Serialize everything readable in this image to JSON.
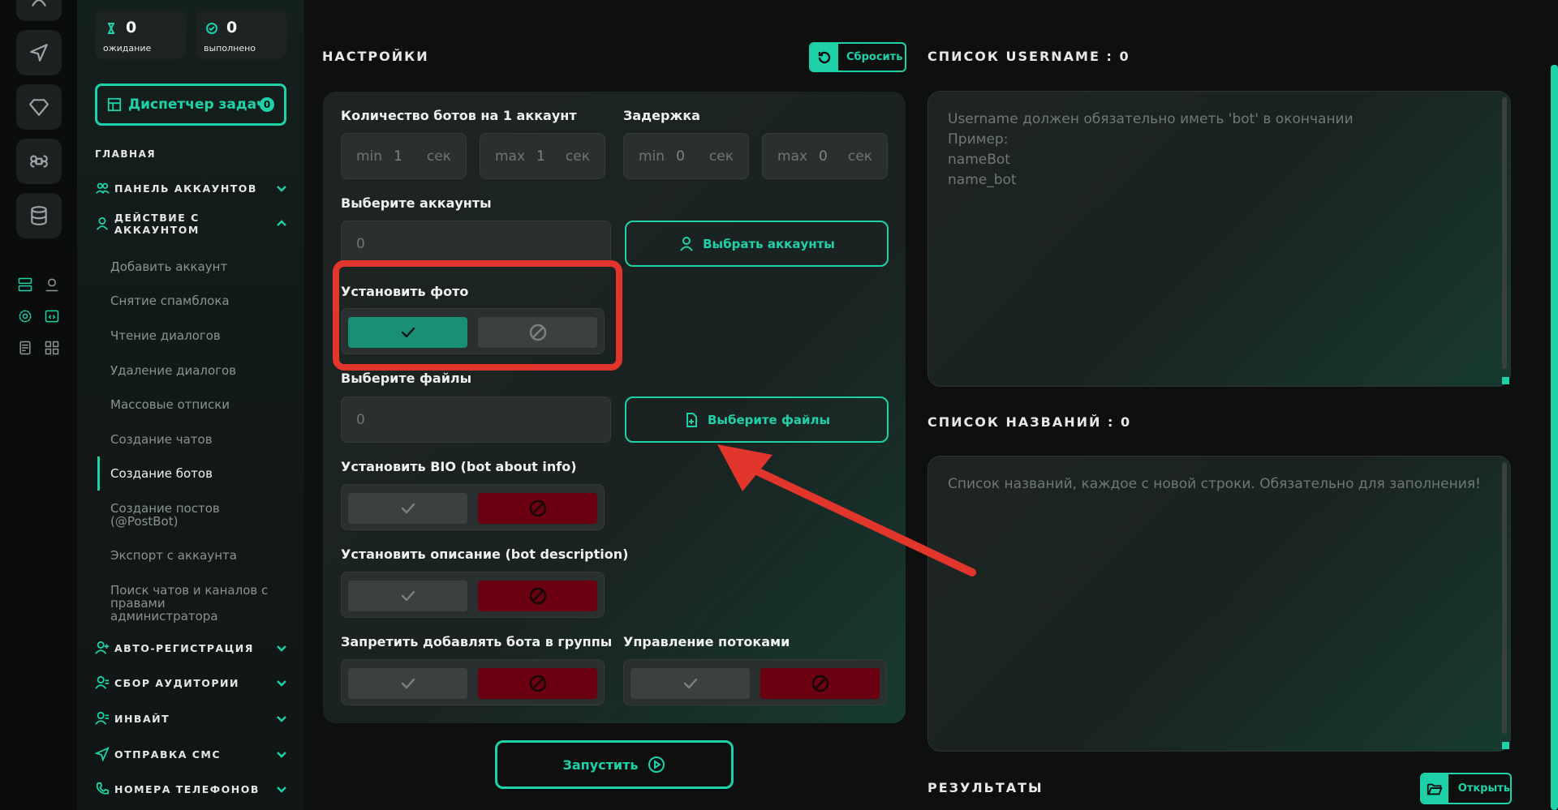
{
  "colors": {
    "accent": "#1fd1a9",
    "danger": "#6b0010",
    "highlight": "#e2352b"
  },
  "stats": [
    {
      "icon": "hourglass-icon",
      "value": "0",
      "label": "ожидание"
    },
    {
      "icon": "check-circle-icon",
      "value": "0",
      "label": "выполнено"
    }
  ],
  "dispatcher": {
    "label": "Диспетчер задач",
    "count": "0"
  },
  "sidebar": {
    "section_title": "ГЛАВНАЯ",
    "groups_top": [
      {
        "label": "ПАНЕЛЬ АККАУНТОВ"
      },
      {
        "label": "ДЕЙСТВИЕ С АККАУНТОМ"
      }
    ],
    "sub_items": [
      "Добавить аккаунт",
      "Снятие спамблока",
      "Чтение диалогов",
      "Удаление диалогов",
      "Массовые отписки",
      "Создание чатов",
      "Создание ботов",
      "Создание постов (@PostBot)",
      "Экспорт с аккаунта",
      "Поиск чатов и каналов с правами администратора"
    ],
    "active_item": "Создание ботов",
    "groups_bottom": [
      {
        "label": "АВТО-РЕГИСТРАЦИЯ"
      },
      {
        "label": "СБОР АУДИТОРИИ"
      },
      {
        "label": "ИНВАЙТ"
      },
      {
        "label": "ОТПРАВКА СМС"
      },
      {
        "label": "НОМЕРА ТЕЛЕФОНОВ"
      }
    ]
  },
  "settings": {
    "title": "НАСТРОЙКИ",
    "reset_label": "Сбросить",
    "bots_per_account": {
      "label": "Количество ботов на 1 аккаунт",
      "min_prefix": "min",
      "min_value": "1",
      "max_prefix": "max",
      "max_value": "1",
      "unit": "сек"
    },
    "delay": {
      "label": "Задержка",
      "min_prefix": "min",
      "min_value": "0",
      "max_prefix": "max",
      "max_value": "0",
      "unit": "сек"
    },
    "accounts": {
      "label": "Выберите аккаунты",
      "value": "0",
      "button": "Выбрать аккаунты"
    },
    "set_photo": {
      "label": "Установить фото",
      "state": true
    },
    "files": {
      "label": "Выберите файлы",
      "value": "0",
      "button": "Выберите файлы"
    },
    "set_bio": {
      "label": "Установить BIO (bot about info)",
      "state": false
    },
    "set_description": {
      "label": "Установить описание (bot description)",
      "state": false
    },
    "forbid_groups": {
      "label": "Запретить добавлять бота в группы",
      "state": false
    },
    "threads": {
      "label": "Управление потоками",
      "state": false
    },
    "run_label": "Запустить"
  },
  "username_list": {
    "title": "СПИСОК USERNAME : 0",
    "placeholder_lines": [
      "Username должен обязательно иметь 'bot' в окончании",
      "Пример:",
      "nameBot",
      "name_bot"
    ]
  },
  "names_list": {
    "title": "СПИСОК НАЗВАНИЙ : 0",
    "placeholder": "Список названий, каждое с новой строки. Обязательно для заполнения!"
  },
  "results": {
    "title": "РЕЗУЛЬТАТЫ",
    "open_label": "Открыть"
  }
}
